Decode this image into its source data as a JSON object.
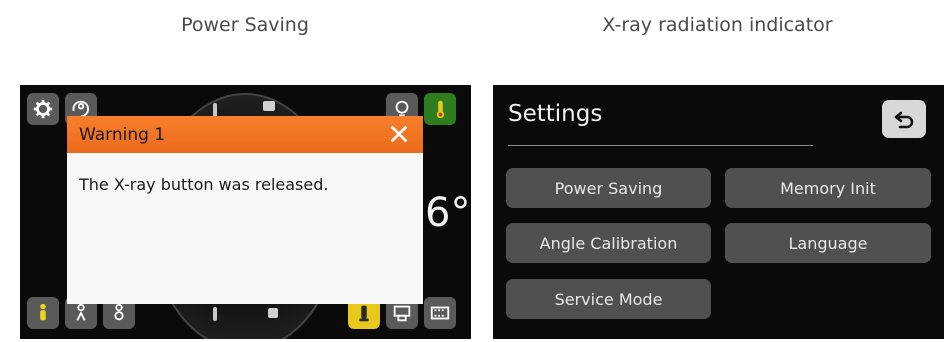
{
  "captions": {
    "left": "Power Saving",
    "right": "X-ray radiation indicator"
  },
  "left_screen": {
    "temperature_digit": "6°",
    "dialog": {
      "title": "Warning 1",
      "message": "The X-ray button was released."
    },
    "icons": {
      "top_left": [
        "gear-icon",
        "person-rotate-icon"
      ],
      "top_right": [
        "bulb-icon",
        "thermometer-icon"
      ],
      "bottom_left": [
        "person-standing-icon",
        "person-outline-icon",
        "person-outline-icon"
      ],
      "bottom_right": [
        "person-highlight-icon",
        "screen-icon",
        "film-icon"
      ]
    },
    "colors": {
      "dialog_header": "#ef6f20",
      "active_icon": "#2e7d1e",
      "yellow_icon": "#e8c81a"
    }
  },
  "right_screen": {
    "title": "Settings",
    "back_icon": "back-arrow-icon",
    "buttons": {
      "power_saving": "Power Saving",
      "memory_init": "Memory Init",
      "angle_calibration": "Angle Calibration",
      "language": "Language",
      "service_mode": "Service Mode"
    }
  }
}
